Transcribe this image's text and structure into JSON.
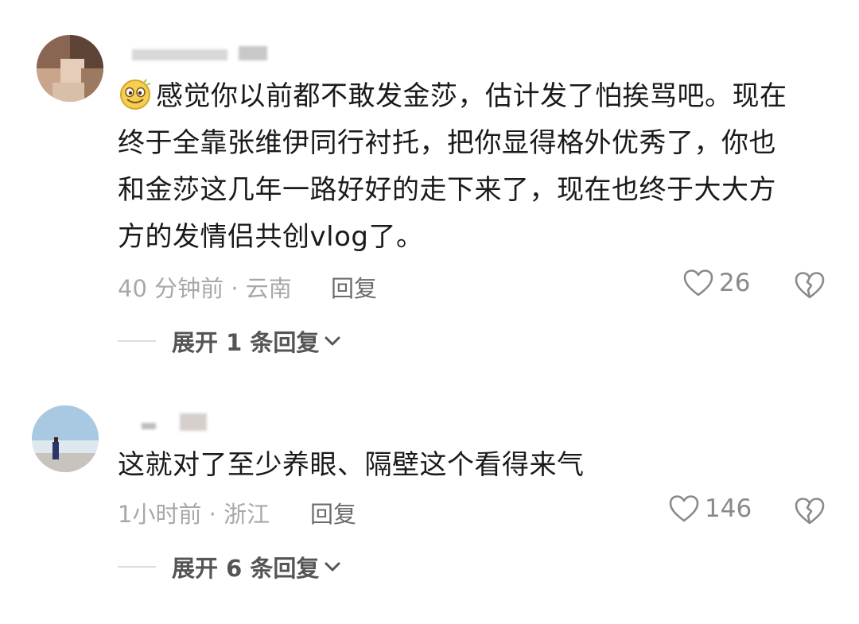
{
  "comments": [
    {
      "text_line1": "感觉你以前都不敢发金莎，估计发了怕挨骂吧。现在",
      "text_line2": "终于全靠张维伊同行衬托，把你显得格外优秀了，你也",
      "text_line3": "和金莎这几年一路好好的走下来了，现在也终于大大方",
      "text_line4": "方的发情侣共创vlog了。",
      "time_location": "40 分钟前 · 云南",
      "reply_label": "回复",
      "like_count": "26",
      "expand_label": "展开 1 条回复"
    },
    {
      "text_line1": "这就对了至少养眼、隔壁这个看得来气",
      "time_location": "1小时前 · 浙江",
      "reply_label": "回复",
      "like_count": "146",
      "expand_label": "展开 6 条回复"
    }
  ],
  "icons": {
    "emoji": "grin-emoji-icon",
    "like": "heart-outline-icon",
    "dislike": "broken-heart-icon",
    "expand": "chevron-down-icon"
  },
  "colors": {
    "text": "#1a1a1a",
    "meta": "#a8a8a8",
    "icon": "#8a8a8a"
  }
}
